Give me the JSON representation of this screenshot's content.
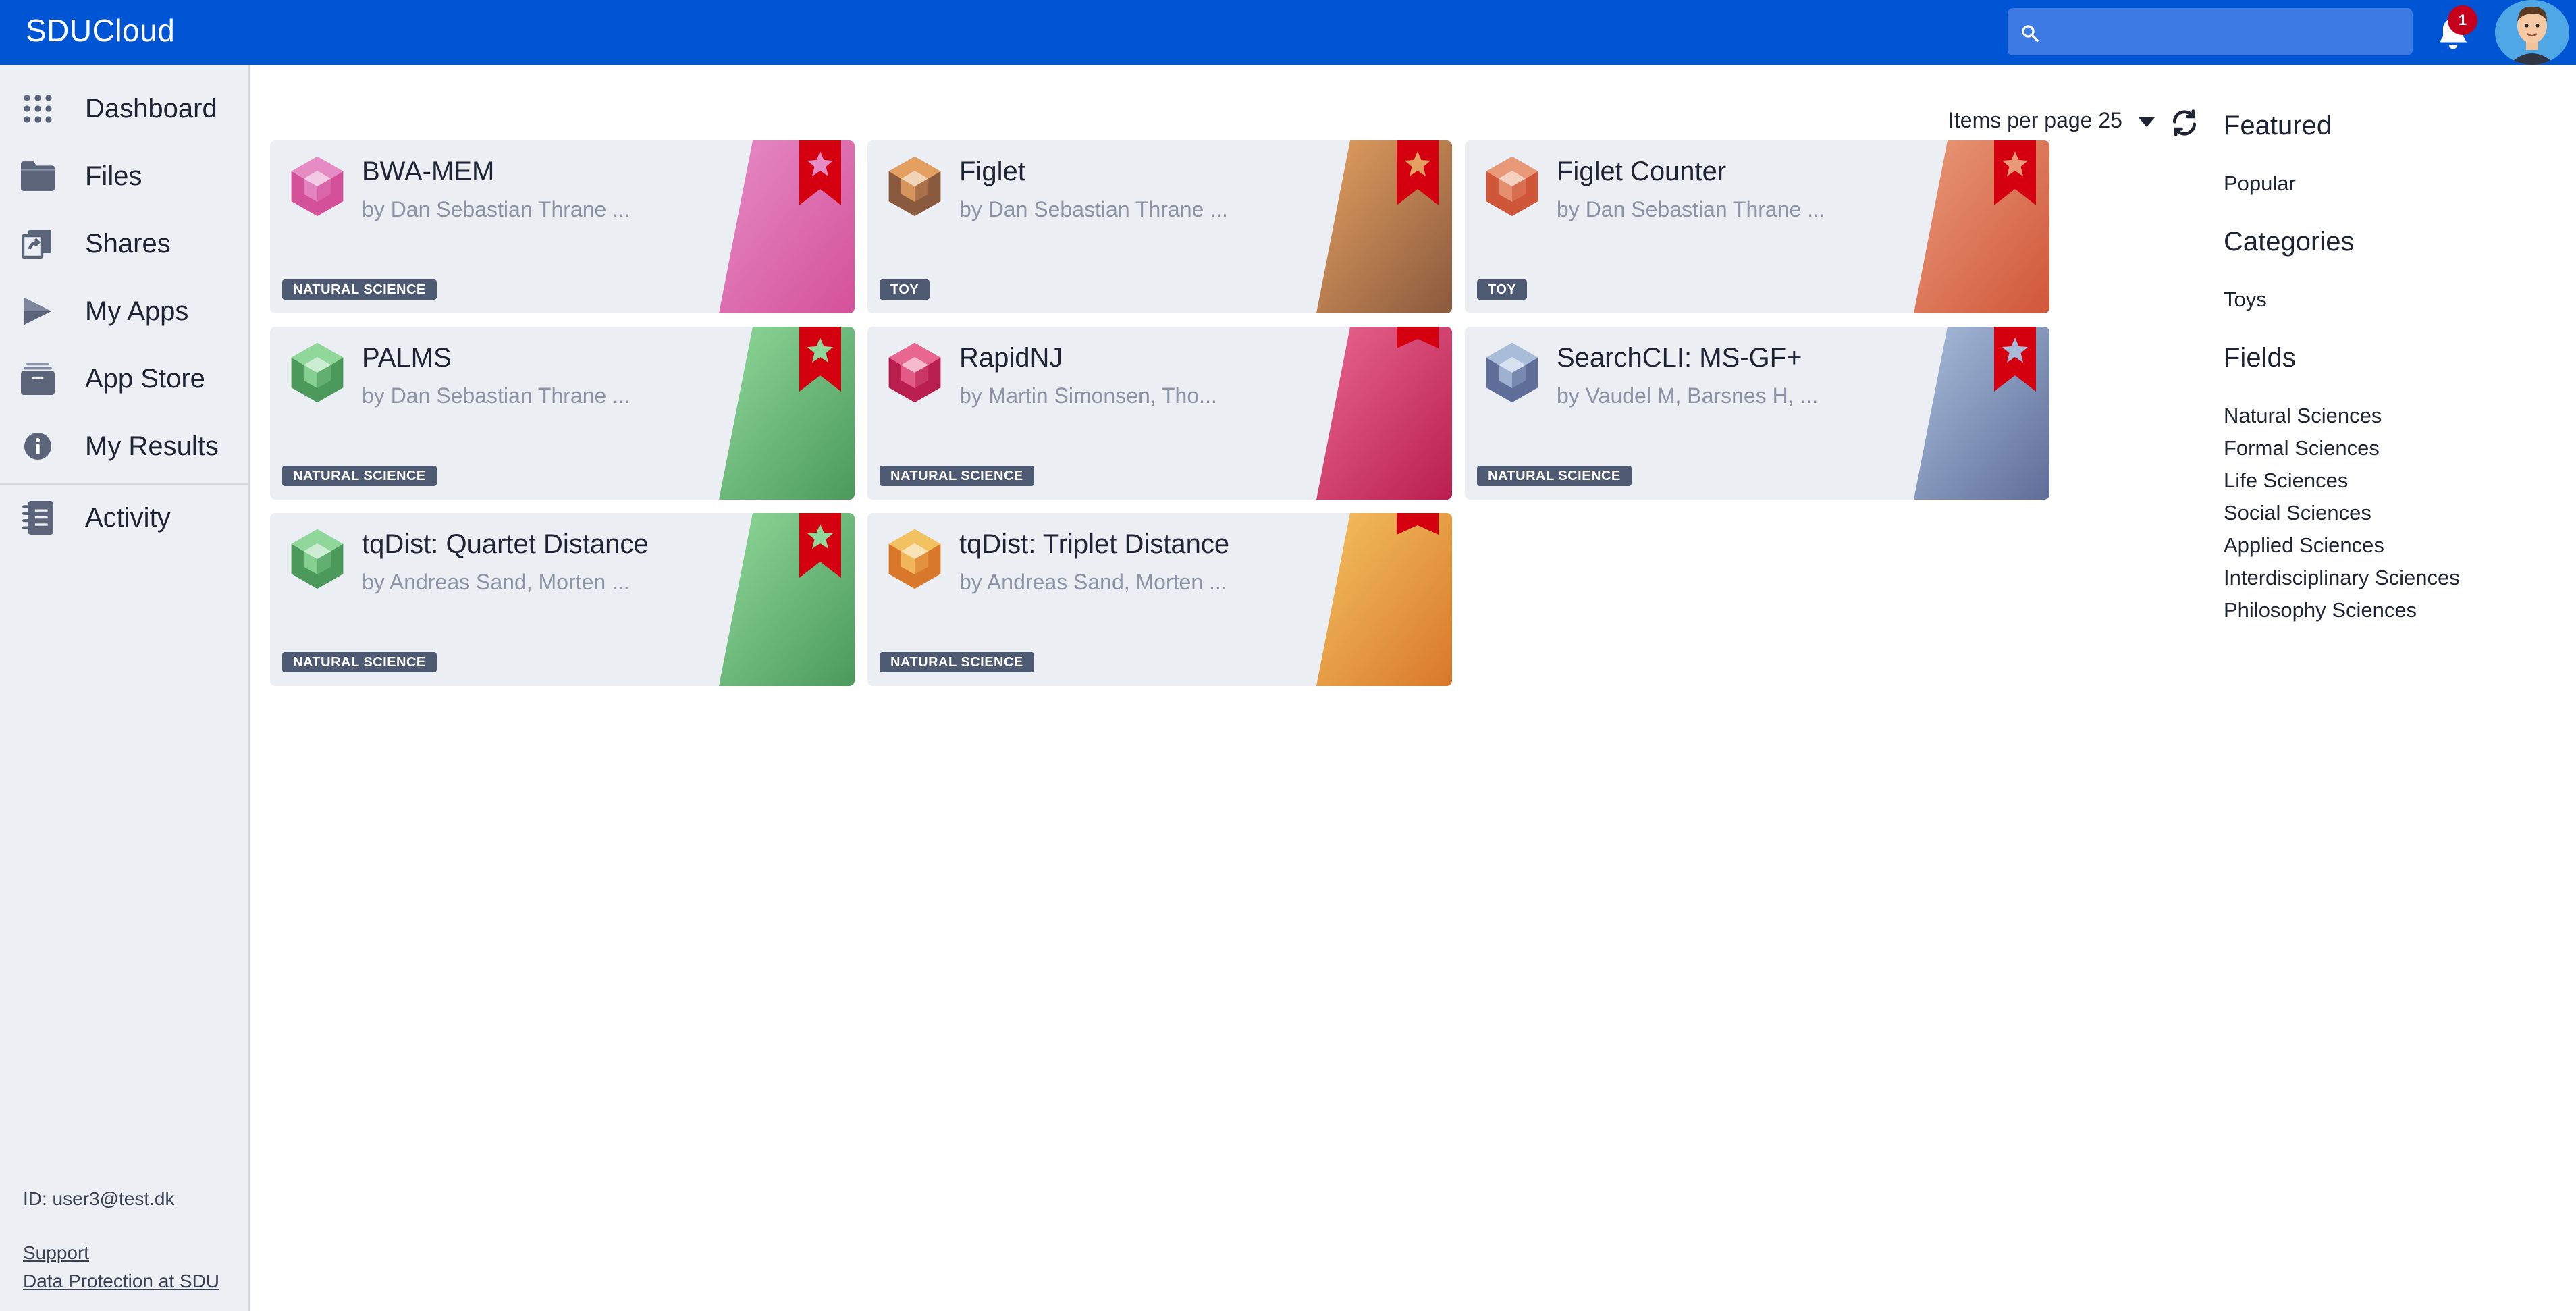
{
  "header": {
    "brand": "SDUCloud",
    "search_placeholder": "",
    "notification_count": "1"
  },
  "sidebar": {
    "items": [
      {
        "label": "Dashboard",
        "icon": "grid-icon"
      },
      {
        "label": "Files",
        "icon": "folder-icon"
      },
      {
        "label": "Shares",
        "icon": "share-icon"
      },
      {
        "label": "My Apps",
        "icon": "play-icon"
      },
      {
        "label": "App Store",
        "icon": "store-icon"
      },
      {
        "label": "My Results",
        "icon": "info-icon"
      },
      {
        "label": "Activity",
        "icon": "notebook-icon"
      }
    ],
    "user_id": "ID: user3@test.dk",
    "support": "Support",
    "data_protection": "Data Protection at SDU"
  },
  "toolbar": {
    "items_per_page_label": "Items per page 25"
  },
  "right_panel": {
    "featured": "Featured",
    "popular": "Popular",
    "categories_heading": "Categories",
    "categories": [
      "Toys"
    ],
    "fields_heading": "Fields",
    "fields": [
      "Natural Sciences",
      "Formal Sciences",
      "Life Sciences",
      "Social Sciences",
      "Applied Sciences",
      "Interdisciplinary Sciences",
      "Philosophy Sciences"
    ]
  },
  "apps": [
    {
      "title": "BWA-MEM",
      "authors": "by Dan Sebastian Thrane ...",
      "tag": "NATURAL SCIENCE",
      "color": "#d4519a",
      "color_light": "#e58cc5",
      "favorite": true
    },
    {
      "title": "Figlet",
      "authors": "by Dan Sebastian Thrane ...",
      "tag": "TOY",
      "color": "#8a5a3e",
      "color_light": "#e3a060",
      "favorite": true
    },
    {
      "title": "Figlet Counter",
      "authors": "by Dan Sebastian Thrane ...",
      "tag": "TOY",
      "color": "#d0563a",
      "color_light": "#e89a78",
      "favorite": true
    },
    {
      "title": "PALMS",
      "authors": "by Dan Sebastian Thrane ...",
      "tag": "NATURAL SCIENCE",
      "color": "#4b9a5c",
      "color_light": "#8fd89a",
      "favorite": true
    },
    {
      "title": "RapidNJ",
      "authors": "by Martin Simonsen, Tho...",
      "tag": "NATURAL SCIENCE",
      "color": "#b91f4e",
      "color_light": "#e86690",
      "favorite": false
    },
    {
      "title": "SearchCLI: MS-GF+",
      "authors": "by Vaudel M, Barsnes H, ...",
      "tag": "NATURAL SCIENCE",
      "color": "#5f6e99",
      "color_light": "#a9bddb",
      "favorite": true
    },
    {
      "title": "tqDist: Quartet Distance",
      "authors": "by Andreas Sand, Morten ...",
      "tag": "NATURAL SCIENCE",
      "color": "#4b9a5c",
      "color_light": "#8fd89a",
      "favorite": true
    },
    {
      "title": "tqDist: Triplet Distance",
      "authors": "by Andreas Sand, Morten ...",
      "tag": "NATURAL SCIENCE",
      "color": "#d9782a",
      "color_light": "#f3c260",
      "favorite": false
    }
  ]
}
